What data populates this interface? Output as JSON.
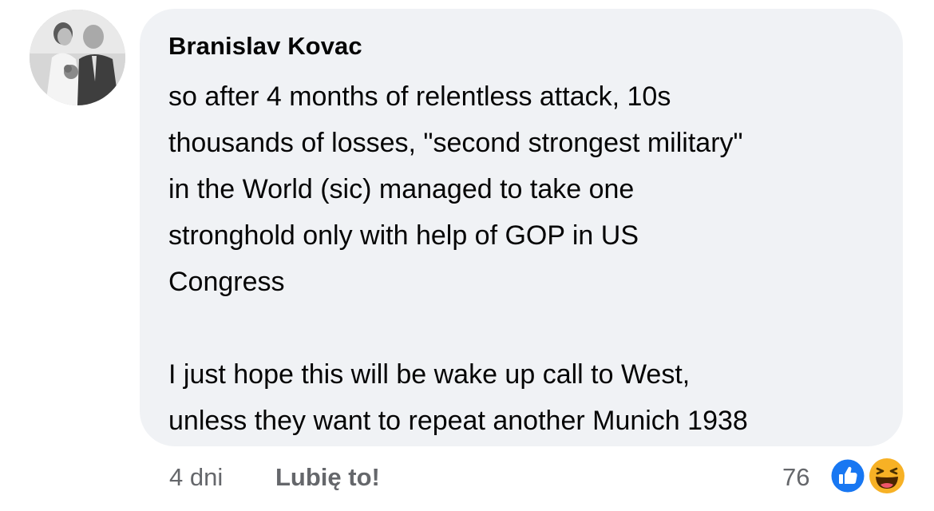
{
  "comment": {
    "author": "Branislav Kovac",
    "text": "so after 4 months of relentless attack, 10s\nthousands of losses, \"second strongest military\"\nin the World (sic) managed to take one\nstronghold only with help of GOP in US\nCongress\n\nI just hope this will be wake up call to West,\nunless they want to repeat another Munich 1938",
    "time": "4 dni",
    "like_label": "Lubię to!",
    "reaction_count": "76",
    "reactions": [
      "like-icon",
      "haha-icon"
    ]
  },
  "colors": {
    "bubble": "#f0f2f5",
    "text": "#050505",
    "secondary_text": "#65676b",
    "like_blue": "#1877f2",
    "haha_yellow": "#f7b125"
  }
}
